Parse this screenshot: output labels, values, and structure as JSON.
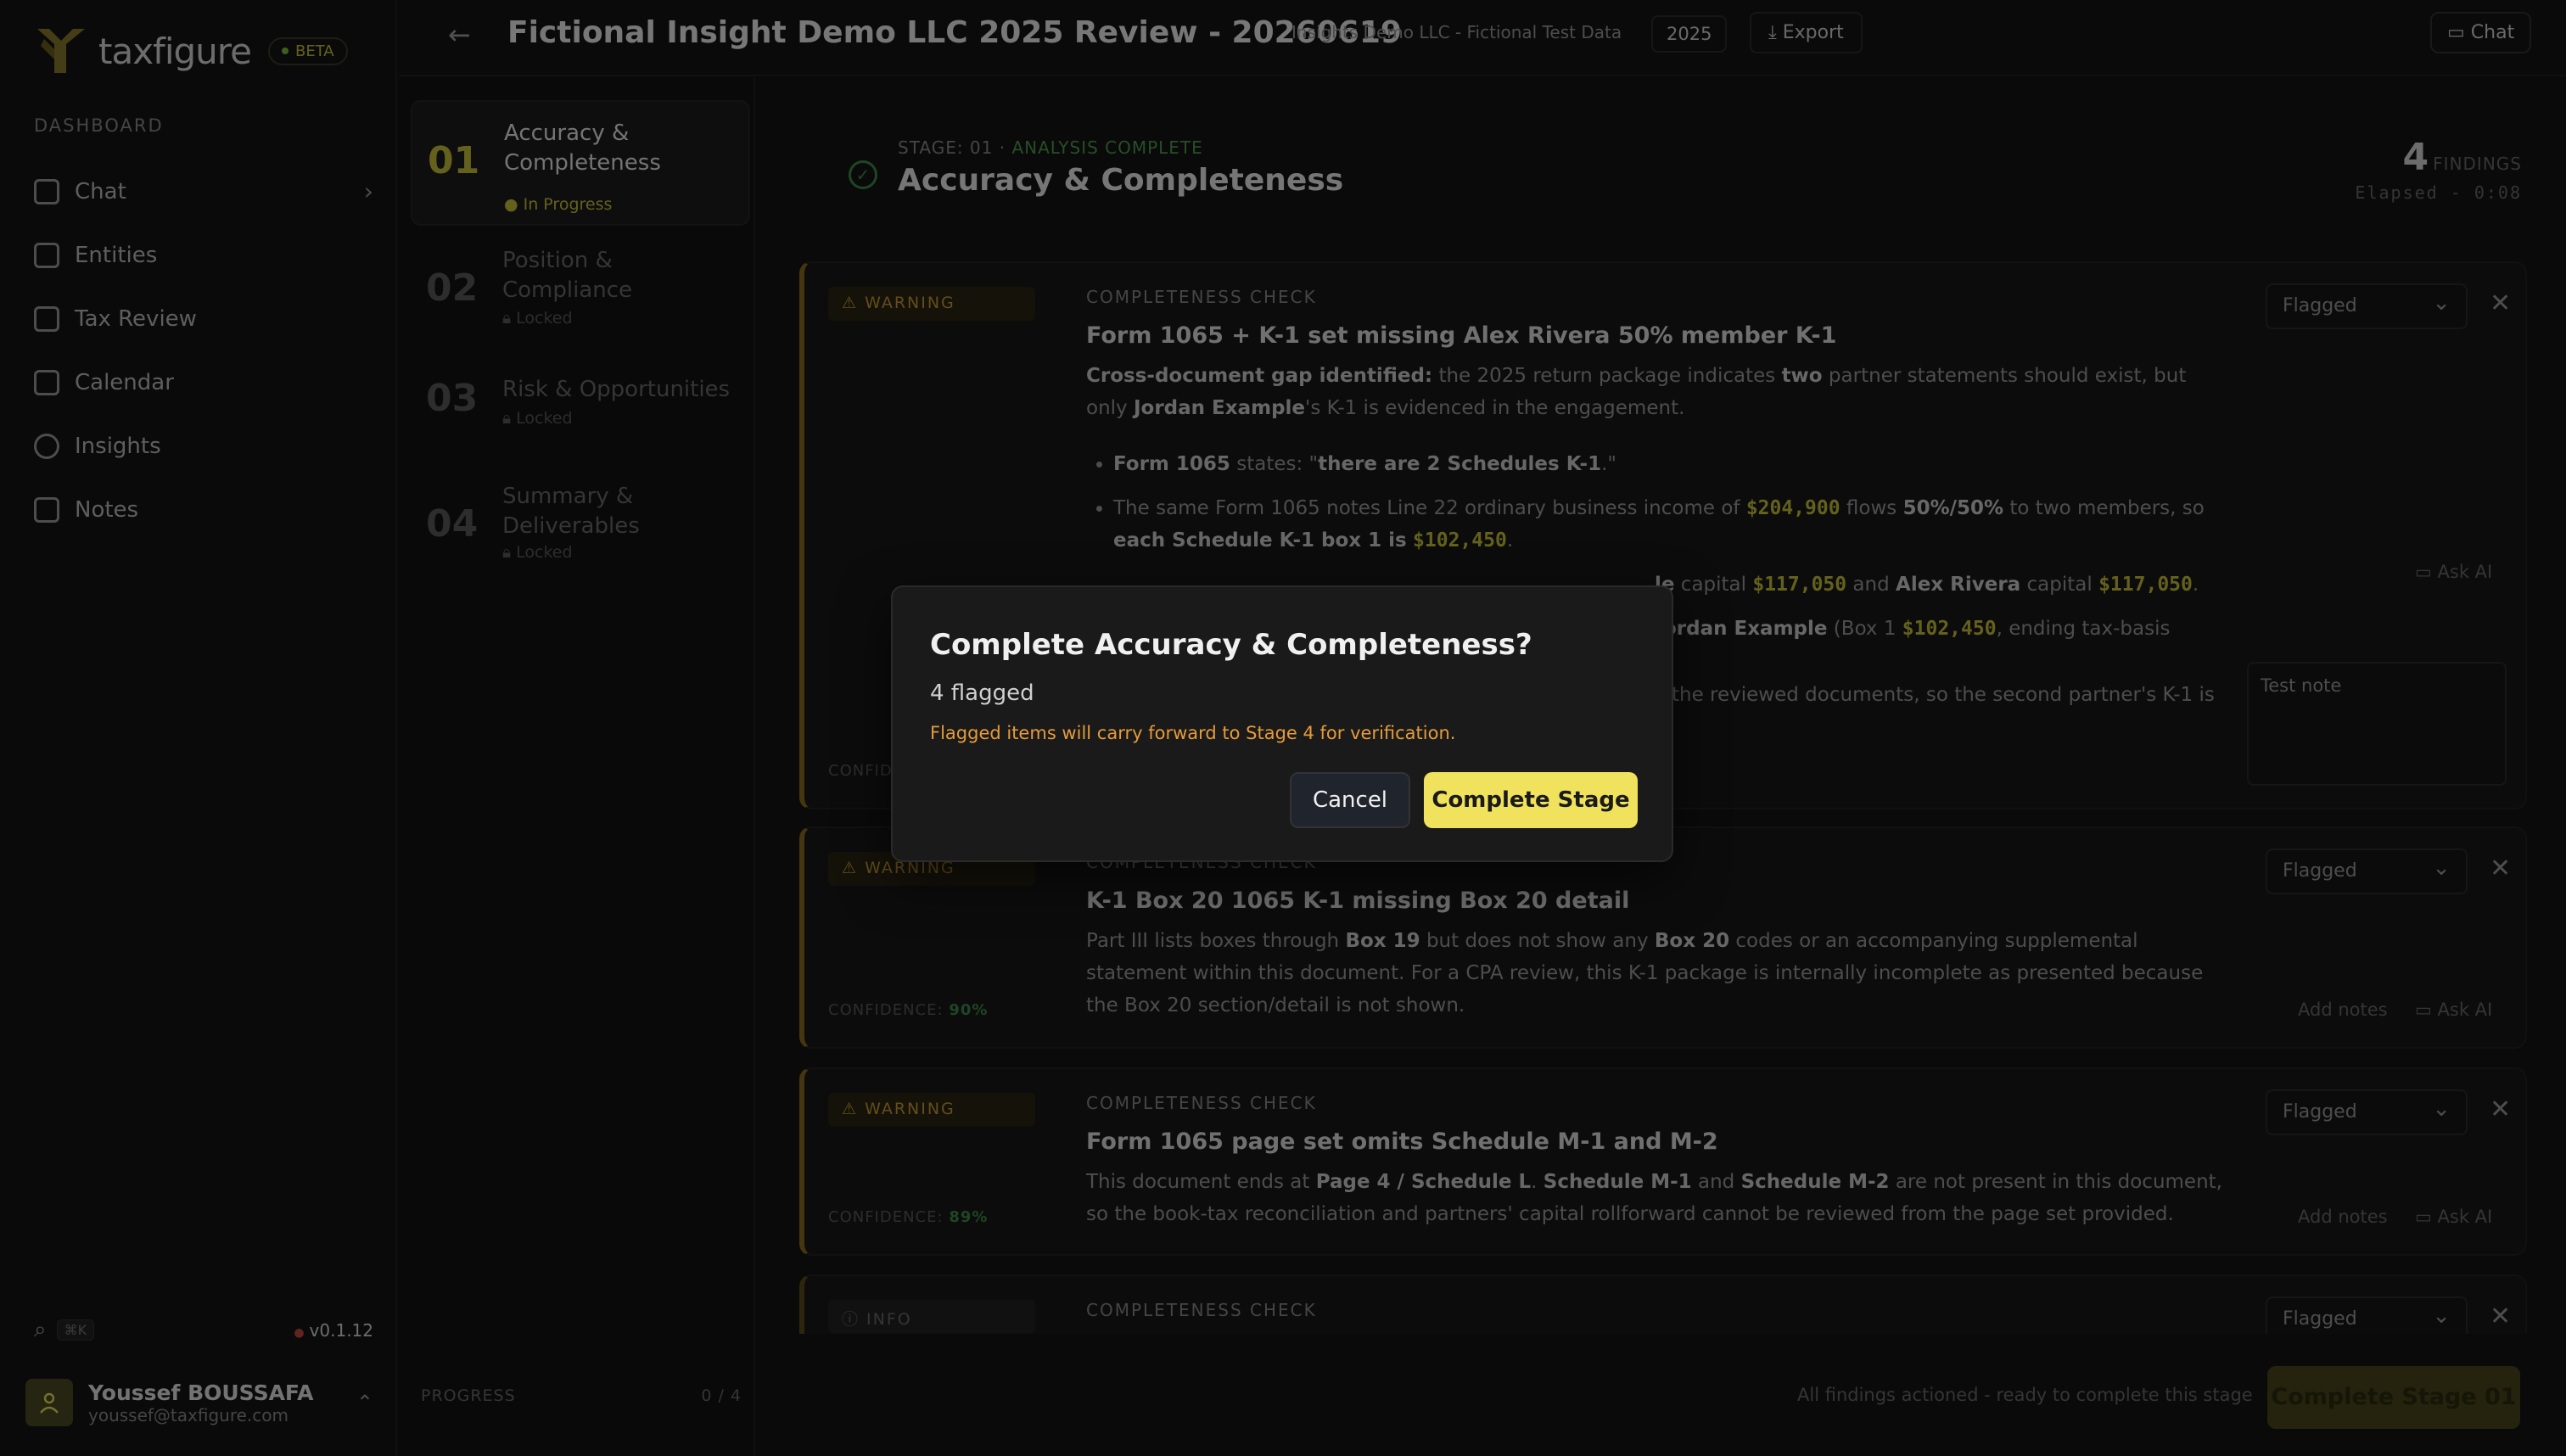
{
  "brand": {
    "name": "taxfigure",
    "badge": "BETA"
  },
  "sidebar": {
    "section_label": "DASHBOARD",
    "items": [
      {
        "label": "Chat",
        "icon": "chat-icon"
      },
      {
        "label": "Entities",
        "icon": "building-icon"
      },
      {
        "label": "Tax Review",
        "icon": "clipboard-icon"
      },
      {
        "label": "Calendar",
        "icon": "calendar-icon"
      },
      {
        "label": "Insights",
        "icon": "lightbulb-icon"
      },
      {
        "label": "Notes",
        "icon": "file-icon"
      }
    ],
    "shortcut": "⌘K",
    "version": "v0.1.12",
    "user": {
      "name": "Youssef BOUSSAFA",
      "email": "youssef@taxfigure.com"
    }
  },
  "header": {
    "title": "Fictional Insight Demo LLC 2025 Review - 20260619",
    "subtitle": "Insights Demo LLC - Fictional Test Data",
    "year": "2025",
    "export_label": "Export",
    "chat_label": "Chat"
  },
  "stages": [
    {
      "num": "01",
      "name": "Accuracy & Completeness",
      "status": "In Progress"
    },
    {
      "num": "02",
      "name": "Position & Compliance",
      "status": "Locked"
    },
    {
      "num": "03",
      "name": "Risk & Opportunities",
      "status": "Locked"
    },
    {
      "num": "04",
      "name": "Summary & Deliverables",
      "status": "Locked"
    }
  ],
  "progress": {
    "label": "PROGRESS",
    "value": "0 / 4"
  },
  "stage_header": {
    "stage_label": "STAGE: 01",
    "status": "ANALYSIS COMPLETE",
    "title": "Accuracy & Completeness",
    "findings_count": "4",
    "findings_label": "FINDINGS",
    "elapsed": "Elapsed - 0:08"
  },
  "findings": [
    {
      "severity": "WARNING",
      "type": "COMPLETENESS CHECK",
      "title": "Form 1065 + K-1 set missing Alex Rivera 50% member K-1",
      "status": "Flagged",
      "confidence_label": "CONFIDENCE:",
      "ask_ai": "Ask AI",
      "note": "Test note",
      "p1_a": "Cross-document gap identified:",
      "p1_b": " the 2025 return package indicates ",
      "p1_c": "two",
      "p1_d": " partner statements should exist, but only ",
      "p1_e": "Jordan Example",
      "p1_f": "'s K-1 is evidenced in the engagement.",
      "b1_a": "Form 1065",
      "b1_b": " states: \"",
      "b1_c": "there are 2 Schedules K-1",
      "b1_d": ".\"",
      "b2_a": "The same Form 1065 notes Line 22 ordinary business income of ",
      "b2_amt1": "$204,900",
      "b2_b": " flows ",
      "b2_c": "50%/50%",
      "b2_d": " to two members, so ",
      "b2_e": "each Schedule K-1 box 1 is",
      "b2_amt2": "$102,450",
      "b2_f": ".",
      "b3_a": "le",
      "b3_b": " capital ",
      "b3_amt1": "$117,050",
      "b3_c": " and ",
      "b3_d": "Alex Rivera",
      "b3_e": " capital ",
      "b3_amt2": "$117,050",
      "b3_f": ".",
      "b4_a": "ordan Example",
      "b4_b": " (Box 1 ",
      "b4_amt": "$102,450",
      "b4_c": ", ending tax-basis",
      "b5": "the reviewed documents, so the second partner's K-1 is"
    },
    {
      "severity": "WARNING",
      "type": "COMPLETENESS CHECK",
      "title": "K-1 Box 20 1065 K-1 missing Box 20 detail",
      "status": "Flagged",
      "confidence_label": "CONFIDENCE:",
      "confidence": "90%",
      "add_notes": "Add notes",
      "ask_ai": "Ask AI",
      "p_a": "Part III lists boxes through ",
      "p_b": "Box 19",
      "p_c": " but does not show any ",
      "p_d": "Box 20",
      "p_e": " codes or an accompanying supplemental statement within this document. For a CPA review, this K-1 package is internally incomplete as presented because the Box 20 section/detail is not shown."
    },
    {
      "severity": "WARNING",
      "type": "COMPLETENESS CHECK",
      "title": "Form 1065 page set omits Schedule M-1 and M-2",
      "status": "Flagged",
      "confidence_label": "CONFIDENCE:",
      "confidence": "89%",
      "add_notes": "Add notes",
      "ask_ai": "Ask AI",
      "p_a": "This document ends at ",
      "p_b": "Page 4 / Schedule L",
      "p_c": ". ",
      "p_d": "Schedule M-1",
      "p_e": " and ",
      "p_f": "Schedule M-2",
      "p_g": " are not present in this document, so the book-tax reconciliation and partners' capital rollforward cannot be reviewed from the page set provided."
    },
    {
      "severity": "INFO",
      "type": "COMPLETENESS CHECK",
      "status": "Flagged"
    }
  ],
  "footer": {
    "message": "All findings actioned - ready to complete this stage",
    "complete_label": "Complete Stage 01"
  },
  "modal": {
    "title": "Complete Accuracy & Completeness?",
    "count": "4 flagged",
    "warning": "Flagged items will carry forward to Stage 4 for verification.",
    "cancel": "Cancel",
    "confirm": "Complete Stage"
  },
  "colors": {
    "accent": "#f1e25d",
    "warning": "#c69a33",
    "success": "#3d8a4a",
    "danger": "#c24b3f"
  }
}
